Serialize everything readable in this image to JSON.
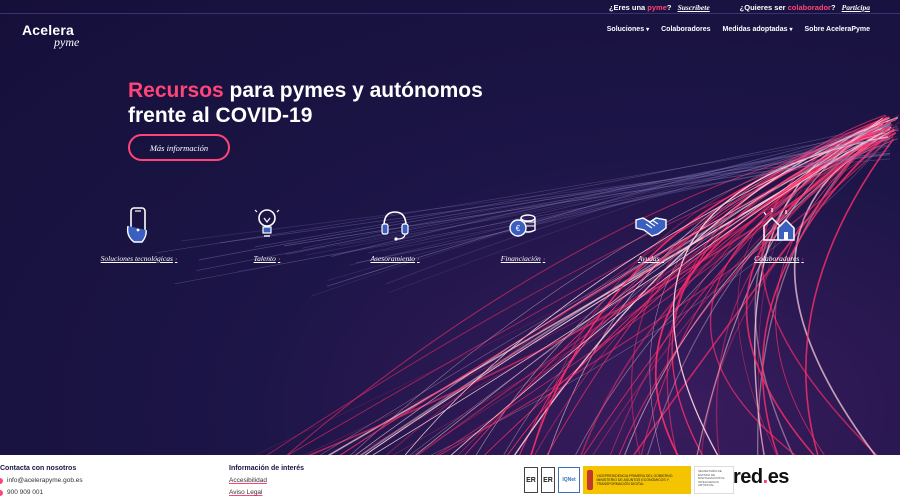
{
  "topbar": {
    "q1_prefix": "¿Eres una ",
    "q1_accent": "pyme",
    "q1_suffix": "?",
    "q1_link": "Suscríbete",
    "q2_prefix": "¿Quieres ser ",
    "q2_accent": "colaborador",
    "q2_suffix": "?",
    "q2_link": "Participa"
  },
  "logo": {
    "main": "Acelera",
    "sub": "pyme"
  },
  "nav": {
    "items": [
      {
        "label": "Soluciones",
        "dropdown": true
      },
      {
        "label": "Colaboradores",
        "dropdown": false
      },
      {
        "label": "Medidas adoptadas",
        "dropdown": true
      },
      {
        "label": "Sobre AceleraPyme",
        "dropdown": false
      }
    ],
    "chevron": "▾"
  },
  "hero": {
    "accent": "Recursos",
    "line1_rest": " para pymes y autónomos",
    "line2": "frente al COVID-19",
    "cta": "Más información"
  },
  "categories": [
    {
      "label": "Soluciones tecnológicas",
      "icon": "smartphone-icon"
    },
    {
      "label": "Talento",
      "icon": "lightbulb-icon"
    },
    {
      "label": "Asesoramiento",
      "icon": "headset-icon"
    },
    {
      "label": "Financiación",
      "icon": "coins-icon"
    },
    {
      "label": "Ayudas",
      "icon": "handshake-icon"
    },
    {
      "label": "Colaboradores",
      "icon": "houses-icon"
    }
  ],
  "category_arrow": "›",
  "footer": {
    "contact_title": "Contacta con nosotros",
    "email": "info@acelerapyme.gob.es",
    "phone": "900 909 001",
    "info_title": "Información de interés",
    "links": [
      "Accesibilidad",
      "Aviso Legal"
    ],
    "badges": [
      "ER",
      "ER",
      "IQNet"
    ],
    "gov_text": "VICEPRESIDENCIA PRIMERA DEL GOBIERNO MINISTERIO DE ASUNTOS ECONÓMICOS Y TRANSFORMACIÓN DIGITAL",
    "gov2_text": "SECRETARÍA DE ESTADO DE DIGITALIZACIÓN E INTELIGENCIA ARTIFICIAL",
    "redes_a": "red",
    "redes_dot": ".",
    "redes_b": "es"
  },
  "colors": {
    "accent": "#ff4477",
    "background": "#1a1444",
    "footer": "#ffffff"
  }
}
